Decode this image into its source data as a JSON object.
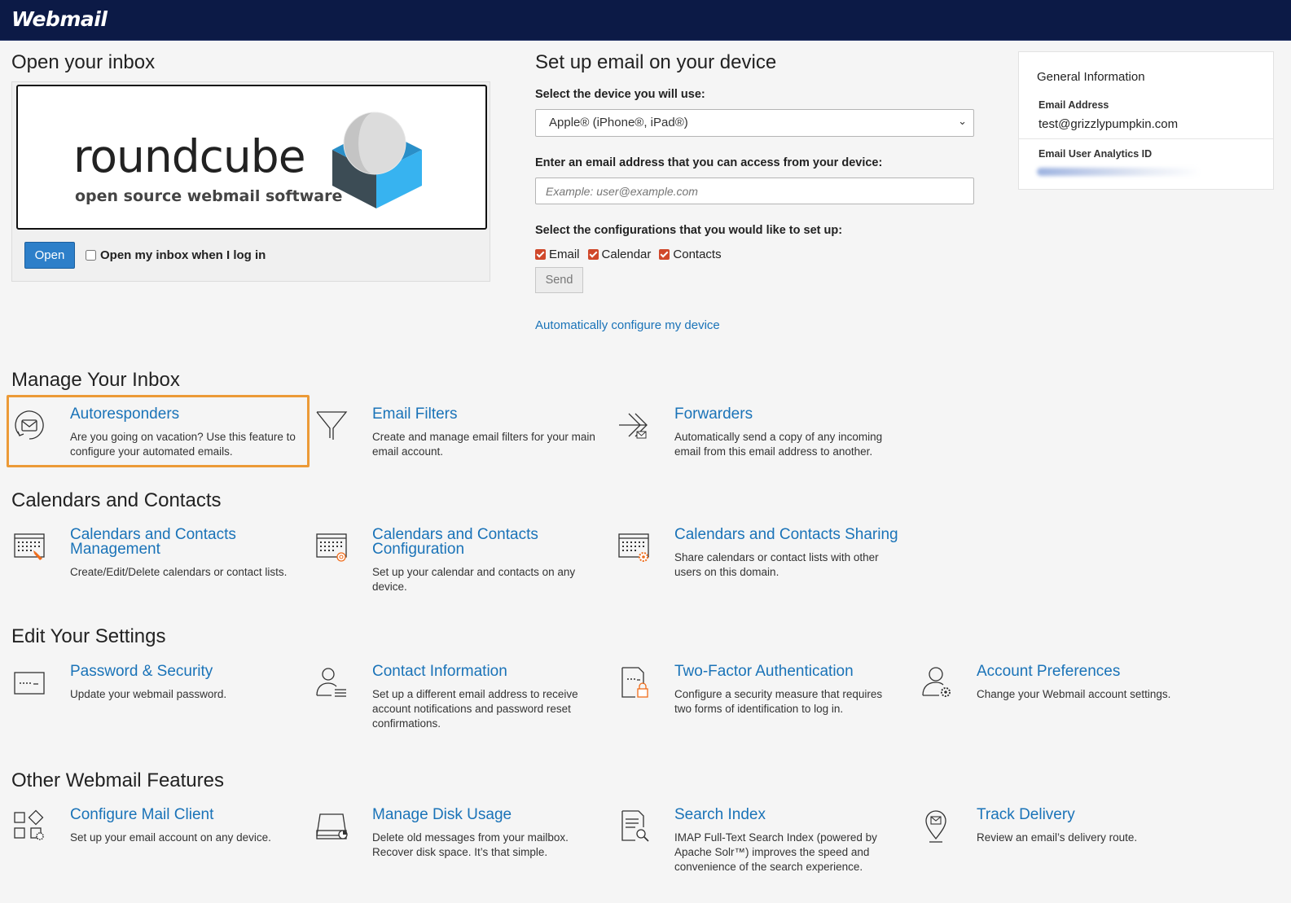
{
  "app": {
    "logo": "Webmail"
  },
  "open_inbox": {
    "heading": "Open your inbox",
    "logo_word": "roundcube",
    "logo_sub": "open source webmail software",
    "open_label": "Open",
    "checkbox_label": "Open my inbox when I log in"
  },
  "setup": {
    "heading": "Set up email on your device",
    "device_label": "Select the device you will use:",
    "device_selected": "Apple® (iPhone®, iPad®)",
    "email_label": "Enter an email address that you can access from your device:",
    "email_placeholder": "Example: user@example.com",
    "config_label": "Select the configurations that you would like to set up:",
    "configs": [
      "Email",
      "Calendar",
      "Contacts"
    ],
    "send_label": "Send",
    "auto_link": "Automatically configure my device"
  },
  "general_info": {
    "title": "General Information",
    "email_label": "Email Address",
    "email_value": "test@grizzlypumpkin.com",
    "analytics_label": "Email User Analytics ID"
  },
  "sections": {
    "manage": {
      "heading": "Manage Your Inbox",
      "items": [
        {
          "title": "Autoresponders",
          "desc": [
            "Are you going on vacation? Use this feature to",
            "configure your automated emails."
          ]
        },
        {
          "title": "Email Filters",
          "desc": [
            "Create and manage email filters for your main",
            "email account."
          ]
        },
        {
          "title": "Forwarders",
          "desc": [
            "Automatically send a copy of any incoming",
            "email from this email address to another."
          ]
        }
      ]
    },
    "calendars": {
      "heading": "Calendars and Contacts",
      "items": [
        {
          "title": [
            "Calendars and Contacts",
            "Management"
          ],
          "desc": [
            "Create/Edit/Delete calendars or contact lists."
          ]
        },
        {
          "title": [
            "Calendars and Contacts",
            "Configuration"
          ],
          "desc": [
            "Set up your calendar and contacts on any",
            "device."
          ]
        },
        {
          "title": [
            "Calendars and Contacts Sharing"
          ],
          "desc": [
            "Share calendars or contact lists with other",
            "users on this domain."
          ]
        }
      ]
    },
    "settings": {
      "heading": "Edit Your Settings",
      "items": [
        {
          "title": "Password & Security",
          "desc": [
            "Update your webmail password."
          ]
        },
        {
          "title": "Contact Information",
          "desc": [
            "Set up a different email address to receive",
            "account notifications and password reset",
            "confirmations."
          ]
        },
        {
          "title": "Two-Factor Authentication",
          "desc": [
            "Configure a security measure that requires",
            "two forms of identification to log in."
          ]
        },
        {
          "title": "Account Preferences",
          "desc": [
            "Change your Webmail account settings."
          ]
        }
      ]
    },
    "other": {
      "heading": "Other Webmail Features",
      "items": [
        {
          "title": "Configure Mail Client",
          "desc": [
            "Set up your email account on any device."
          ]
        },
        {
          "title": "Manage Disk Usage",
          "desc": [
            "Delete old messages from your mailbox.",
            "Recover disk space. It’s that simple."
          ]
        },
        {
          "title": "Search Index",
          "desc": [
            "IMAP Full-Text Search Index (powered by",
            "Apache Solr™) improves the speed and",
            "convenience of the search experience."
          ]
        },
        {
          "title": "Track Delivery",
          "desc": [
            "Review an email’s delivery route."
          ]
        }
      ]
    }
  },
  "icons": {
    "autoresponders": "envelope-circle-icon",
    "email_filters": "funnel-icon",
    "forwarders": "forward-arrow-icon",
    "cal_management": "calendar-edit-icon",
    "cal_configuration": "calendar-at-icon",
    "cal_sharing": "calendar-gear-icon",
    "password": "password-field-icon",
    "contact_info": "user-card-icon",
    "two_factor": "document-lock-icon",
    "account_prefs": "user-gear-icon",
    "mail_client": "apps-grid-icon",
    "disk_usage": "hard-drive-icon",
    "search_index": "document-search-icon",
    "track_delivery": "map-pin-envelope-icon"
  },
  "colors": {
    "header_bg": "#0c1a46",
    "link": "#1a73b8",
    "open_button": "#2d7fc9",
    "checkbox": "#d0482b",
    "highlight": "#ec9a37"
  }
}
